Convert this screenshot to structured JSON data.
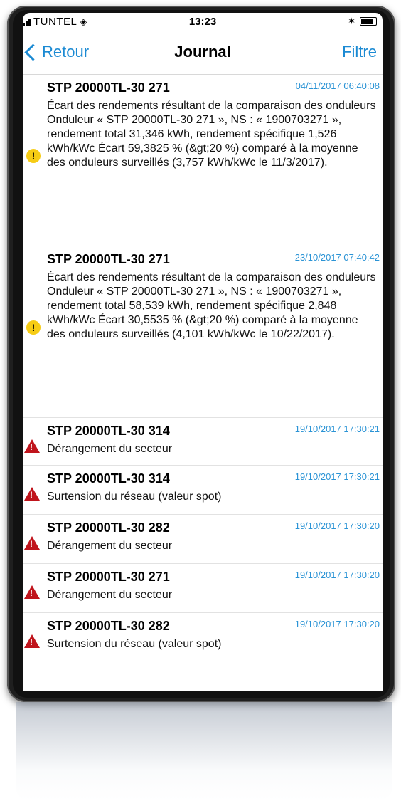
{
  "status_bar": {
    "carrier": "TUNTEL",
    "time": "13:23"
  },
  "nav": {
    "back_label": "Retour",
    "title": "Journal",
    "filter_label": "Filtre"
  },
  "entries": [
    {
      "title": "STP 20000TL-30 271",
      "timestamp": "04/11/2017 06:40:08",
      "severity": "warning",
      "message": "Écart des rendements résultant de la comparaison des onduleurs Onduleur « STP 20000TL-30 271 », NS : « 1900703271 », rendement total 31,346 kWh, rendement spécifique 1,526 kWh/kWc Écart 59,3825 % (&gt;20 %) comparé à la moyenne des onduleurs surveillés (3,757 kWh/kWc le 11/3/2017)."
    },
    {
      "title": "STP 20000TL-30 271",
      "timestamp": "23/10/2017 07:40:42",
      "severity": "warning",
      "message": "Écart des rendements résultant de la comparaison des onduleurs Onduleur « STP 20000TL-30 271 », NS : « 1900703271 », rendement total 58,539 kWh, rendement spécifique 2,848 kWh/kWc Écart 30,5535 % (&gt;20 %) comparé à la moyenne des onduleurs surveillés (4,101 kWh/kWc le 10/22/2017)."
    },
    {
      "title": "STP 20000TL-30 314",
      "timestamp": "19/10/2017 17:30:21",
      "severity": "error",
      "message": "Dérangement du secteur"
    },
    {
      "title": "STP 20000TL-30 314",
      "timestamp": "19/10/2017 17:30:21",
      "severity": "error",
      "message": "Surtension du réseau (valeur spot)"
    },
    {
      "title": "STP 20000TL-30 282",
      "timestamp": "19/10/2017 17:30:20",
      "severity": "error",
      "message": "Dérangement du secteur"
    },
    {
      "title": "STP 20000TL-30 271",
      "timestamp": "19/10/2017 17:30:20",
      "severity": "error",
      "message": "Dérangement du secteur"
    },
    {
      "title": "STP 20000TL-30 282",
      "timestamp": "19/10/2017 17:30:20",
      "severity": "error",
      "message": "Surtension du réseau (valeur spot)"
    }
  ],
  "colors": {
    "accent": "#1b8ad3",
    "warning": "#f6cc15",
    "error": "#c0141c"
  }
}
